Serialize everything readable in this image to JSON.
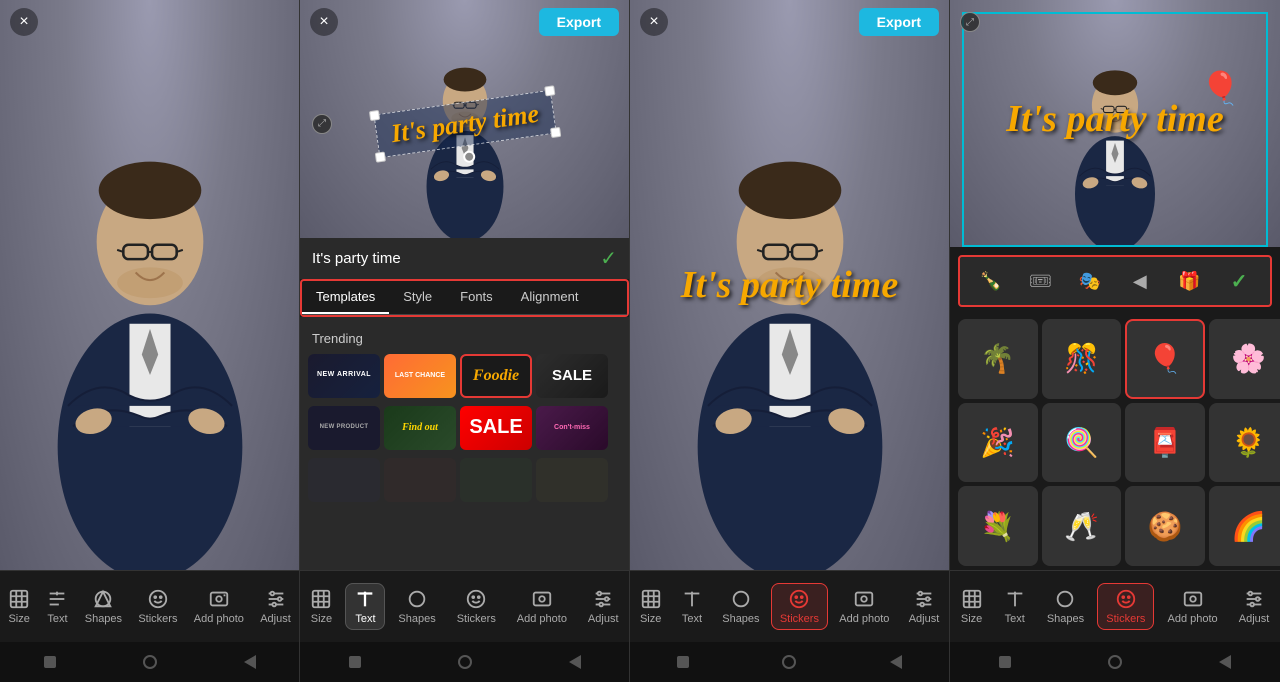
{
  "panels": [
    {
      "id": "panel1",
      "type": "plain-photo",
      "close_label": "×",
      "toolbar": {
        "items": [
          {
            "id": "size",
            "label": "Size",
            "icon": "⊞"
          },
          {
            "id": "text",
            "label": "Text",
            "icon": "T",
            "active": false
          },
          {
            "id": "shapes",
            "label": "Shapes",
            "icon": "◇"
          },
          {
            "id": "stickers",
            "label": "Stickers",
            "icon": "☺"
          },
          {
            "id": "add_photo",
            "label": "Add photo",
            "icon": "⊕"
          },
          {
            "id": "adjust",
            "label": "Adjust",
            "icon": "⇋"
          }
        ]
      }
    },
    {
      "id": "panel2",
      "type": "text-editor",
      "close_label": "×",
      "export_label": "Export",
      "text_value": "It's party time",
      "check_label": "✓",
      "tabs": [
        {
          "id": "templates",
          "label": "Templates",
          "active": true
        },
        {
          "id": "style",
          "label": "Style",
          "active": false
        },
        {
          "id": "fonts",
          "label": "Fonts",
          "active": false
        },
        {
          "id": "alignment",
          "label": "Alignment",
          "active": false
        }
      ],
      "trending_label": "Trending",
      "templates": [
        {
          "id": "new-arrival",
          "text": "NEW ARRIVAL",
          "style": "new-arrival"
        },
        {
          "id": "last-chance",
          "text": "LAST CHANCE",
          "style": "last-chance"
        },
        {
          "id": "foodie",
          "text": "Foodie",
          "style": "foodie",
          "selected": true
        },
        {
          "id": "sale",
          "text": "SALE",
          "style": "sale"
        }
      ],
      "templates_row2": [
        {
          "id": "new-product",
          "text": "NEW PRODUCT",
          "style": "new-product"
        },
        {
          "id": "find-out",
          "text": "Find out",
          "style": "find-out"
        },
        {
          "id": "sale-big",
          "text": "SALE",
          "style": "sale-big"
        },
        {
          "id": "cont-miss",
          "text": "Con't-miss",
          "style": "cont-miss"
        }
      ],
      "toolbar": {
        "items": [
          {
            "id": "size",
            "label": "Size",
            "icon": "⊞"
          },
          {
            "id": "text",
            "label": "Text",
            "icon": "T",
            "active": true
          },
          {
            "id": "shapes",
            "label": "Shapes",
            "icon": "◇"
          },
          {
            "id": "stickers",
            "label": "Stickers",
            "icon": "☺"
          },
          {
            "id": "add_photo",
            "label": "Add photo",
            "icon": "⊕"
          },
          {
            "id": "adjust",
            "label": "Adjust",
            "icon": "⇋"
          }
        ]
      }
    },
    {
      "id": "panel3",
      "type": "sticker-viewer",
      "close_label": "×",
      "export_label": "Export",
      "toolbar": {
        "items": [
          {
            "id": "size",
            "label": "Size",
            "icon": "⊞"
          },
          {
            "id": "text",
            "label": "Text",
            "icon": "T"
          },
          {
            "id": "shapes",
            "label": "Shapes",
            "icon": "◇"
          },
          {
            "id": "stickers",
            "label": "Stickers",
            "icon": "☺",
            "active": true
          },
          {
            "id": "add_photo",
            "label": "Add photo",
            "icon": "⊕"
          },
          {
            "id": "adjust",
            "label": "Adjust",
            "icon": "⇋"
          }
        ]
      }
    },
    {
      "id": "panel4",
      "type": "sticker-picker",
      "sticker_tools": [
        {
          "id": "bottle",
          "icon": "🍾"
        },
        {
          "id": "ticket",
          "icon": "🎟"
        },
        {
          "id": "mask",
          "icon": "🎭"
        },
        {
          "id": "play",
          "icon": "▶"
        },
        {
          "id": "gift",
          "icon": "🎁"
        },
        {
          "id": "confirm",
          "icon": "✓"
        }
      ],
      "stickers": [
        {
          "id": "palm",
          "emoji": "🌴"
        },
        {
          "id": "confetti",
          "emoji": "🎊"
        },
        {
          "id": "balloons",
          "emoji": "🎈",
          "selected": true
        },
        {
          "id": "flowers",
          "emoji": "🌸"
        },
        {
          "id": "happy",
          "emoji": "🎉"
        },
        {
          "id": "popsicle",
          "emoji": "🍭"
        },
        {
          "id": "postcard",
          "emoji": "📮"
        },
        {
          "id": "orange-flowers",
          "emoji": "🌻"
        },
        {
          "id": "bouquet",
          "emoji": "💐"
        },
        {
          "id": "champagne",
          "emoji": "🥂"
        },
        {
          "id": "cookie",
          "emoji": "🍪"
        },
        {
          "id": "rainbow",
          "emoji": "🌈"
        }
      ],
      "toolbar": {
        "items": [
          {
            "id": "size",
            "label": "Size",
            "icon": "⊞"
          },
          {
            "id": "text",
            "label": "Text",
            "icon": "T"
          },
          {
            "id": "shapes",
            "label": "Shapes",
            "icon": "◇"
          },
          {
            "id": "stickers",
            "label": "Stickers",
            "icon": "☺",
            "active": true
          },
          {
            "id": "add_photo",
            "label": "Add photo",
            "icon": "⊕"
          },
          {
            "id": "adjust",
            "label": "Adjust",
            "icon": "⇋"
          }
        ]
      }
    }
  ],
  "party_text": "It's party time",
  "colors": {
    "export_btn": "#1db8e0",
    "active_tab": "#ffffff",
    "selected_border": "#e53935",
    "text_color": "#f7a800",
    "check_color": "#4caf50"
  }
}
